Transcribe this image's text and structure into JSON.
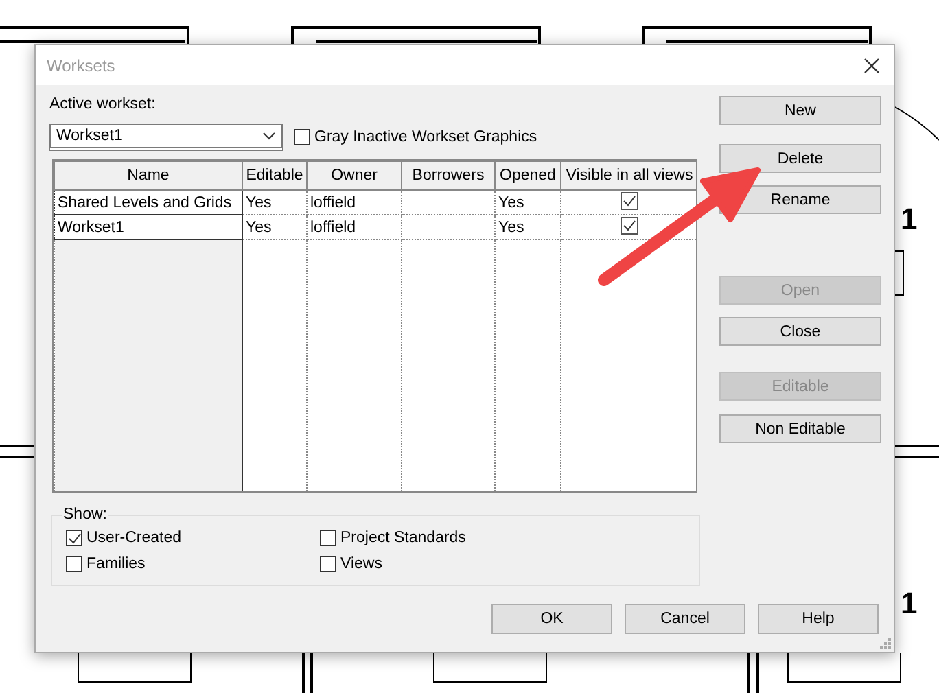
{
  "background": {
    "level_marks": [
      "1",
      "1"
    ]
  },
  "window": {
    "title": "Worksets"
  },
  "active_workset": {
    "label": "Active workset:",
    "value": "Workset1"
  },
  "gray_inactive": {
    "label": "Gray Inactive Workset Graphics",
    "checked": false
  },
  "table": {
    "columns": [
      "Name",
      "Editable",
      "Owner",
      "Borrowers",
      "Opened",
      "Visible in all views"
    ],
    "rows": [
      {
        "name": "Shared Levels and Grids",
        "editable": "Yes",
        "owner": "loffield",
        "opened": "Yes",
        "visible_in_all_views": true
      },
      {
        "name": "Workset1",
        "editable": "Yes",
        "owner": "loffield",
        "opened": "Yes",
        "visible_in_all_views": true
      }
    ]
  },
  "side_buttons": [
    {
      "label": "New",
      "disabled": false
    },
    {
      "label": "Delete",
      "disabled": false
    },
    {
      "label": "Rename",
      "disabled": false
    },
    {
      "label": "Open",
      "disabled": true
    },
    {
      "label": "Close",
      "disabled": false
    },
    {
      "label": "Editable",
      "disabled": true
    },
    {
      "label": "Non Editable",
      "disabled": false
    }
  ],
  "show": {
    "label": "Show:",
    "options": [
      {
        "label": "User-Created",
        "checked": true
      },
      {
        "label": "Project Standards",
        "checked": false
      },
      {
        "label": "Families",
        "checked": false
      },
      {
        "label": "Views",
        "checked": false
      }
    ]
  },
  "footer_buttons": [
    "OK",
    "Cancel",
    "Help"
  ]
}
